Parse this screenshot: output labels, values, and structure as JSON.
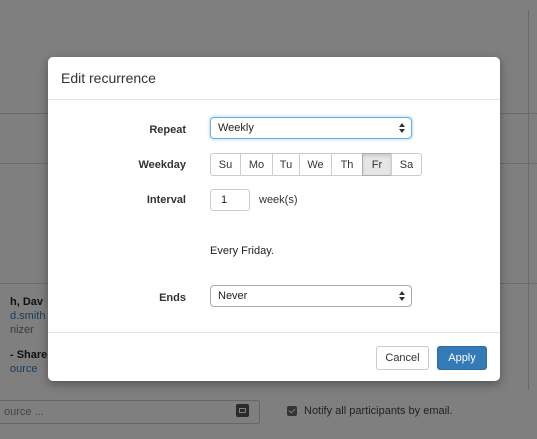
{
  "background": {
    "organizer_name": "h, Dav",
    "organizer_email": "d.smith",
    "organizer_role": "nizer",
    "shared_label": "- Share",
    "shared_link": "ource",
    "source_placeholder": "ource ...",
    "notify_label": "Notify all participants by email."
  },
  "modal": {
    "title": "Edit recurrence",
    "repeat": {
      "label": "Repeat",
      "value": "Weekly"
    },
    "weekday": {
      "label": "Weekday",
      "days": [
        "Su",
        "Mo",
        "Tu",
        "We",
        "Th",
        "Fr",
        "Sa"
      ],
      "selected": "Fr"
    },
    "interval": {
      "label": "Interval",
      "value": "1",
      "unit": "week(s)"
    },
    "summary": "Every Friday.",
    "ends": {
      "label": "Ends",
      "value": "Never"
    },
    "cancel_label": "Cancel",
    "apply_label": "Apply"
  },
  "colors": {
    "primary": "#337ab7",
    "backdrop": "rgba(0,0,0,0.5)",
    "focus_ring": "#66afe9"
  }
}
